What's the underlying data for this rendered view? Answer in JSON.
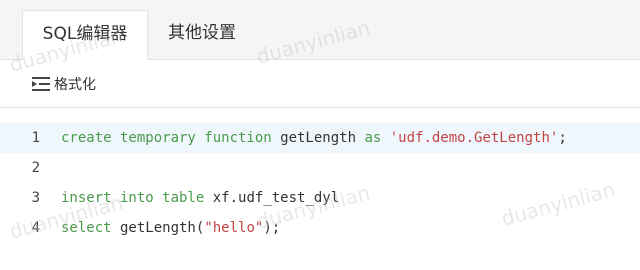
{
  "tabs": [
    {
      "label": "SQL编辑器",
      "active": true
    },
    {
      "label": "其他设置",
      "active": false
    }
  ],
  "toolbar": {
    "format_label": "格式化"
  },
  "editor": {
    "lines": [
      {
        "number": "1"
      },
      {
        "number": "2"
      },
      {
        "number": "3"
      },
      {
        "number": "4"
      }
    ],
    "code": {
      "l1_kw1": "create temporary function",
      "l1_id": " getLength ",
      "l1_kw2": "as",
      "l1_str": "'udf.demo.GetLength'",
      "l1_end": ";",
      "l3_kw": "insert into table",
      "l3_rest": " xf.udf_test_dyl",
      "l4_kw": "select",
      "l4_mid": " getLength(",
      "l4_str": "\"hello\"",
      "l4_end": ");"
    }
  },
  "watermark": "duanyinlian",
  "colors": {
    "keyword": "#4a9a4c",
    "string": "#c24444",
    "current_line": "#f0f7fc"
  }
}
